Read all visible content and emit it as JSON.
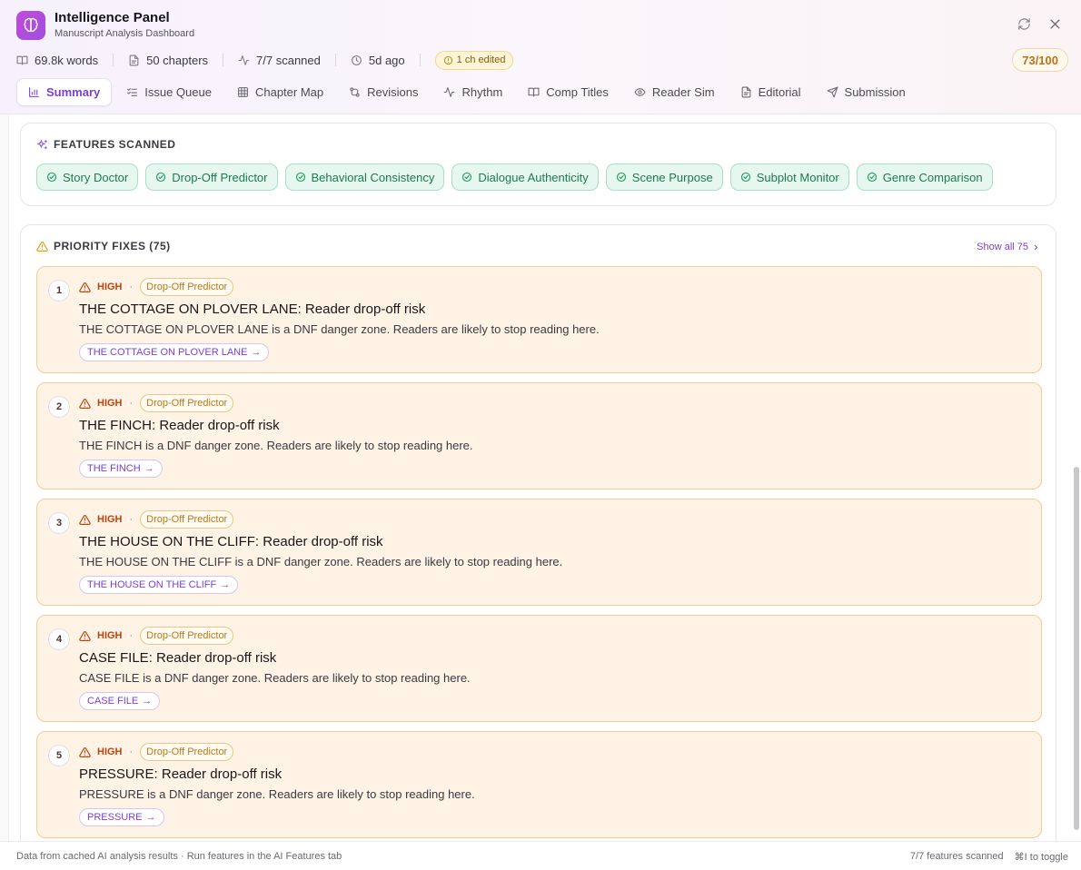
{
  "header": {
    "title": "Intelligence Panel",
    "subtitle": "Manuscript Analysis Dashboard",
    "score": "73/100"
  },
  "stats": {
    "words": "69.8k words",
    "chapters": "50 chapters",
    "scanned": "7/7 scanned",
    "age": "5d ago",
    "edited": "1 ch edited"
  },
  "tabs": [
    {
      "label": "Summary",
      "icon": "bar-chart-icon"
    },
    {
      "label": "Issue Queue",
      "icon": "list-checks-icon"
    },
    {
      "label": "Chapter Map",
      "icon": "grid-icon"
    },
    {
      "label": "Revisions",
      "icon": "git-compare-icon"
    },
    {
      "label": "Rhythm",
      "icon": "activity-icon"
    },
    {
      "label": "Comp Titles",
      "icon": "book-open-icon"
    },
    {
      "label": "Reader Sim",
      "icon": "eye-icon"
    },
    {
      "label": "Editorial",
      "icon": "file-text-icon"
    },
    {
      "label": "Submission",
      "icon": "send-icon"
    }
  ],
  "features": {
    "heading": "FEATURES SCANNED",
    "items": [
      "Story Doctor",
      "Drop-Off Predictor",
      "Behavioral Consistency",
      "Dialogue Authenticity",
      "Scene Purpose",
      "Subplot Monitor",
      "Genre Comparison"
    ]
  },
  "priority": {
    "heading": "PRIORITY FIXES (75)",
    "show_all": "Show all 75",
    "fixes": [
      {
        "num": "1",
        "severity": "HIGH",
        "dot": "·",
        "feature": "Drop-Off Predictor",
        "title": "THE COTTAGE ON PLOVER LANE: Reader drop-off risk",
        "desc": "THE COTTAGE ON PLOVER LANE is a DNF danger zone. Readers are likely to stop reading here.",
        "link": "THE COTTAGE ON PLOVER LANE"
      },
      {
        "num": "2",
        "severity": "HIGH",
        "dot": "·",
        "feature": "Drop-Off Predictor",
        "title": "THE FINCH: Reader drop-off risk",
        "desc": "THE FINCH is a DNF danger zone. Readers are likely to stop reading here.",
        "link": "THE FINCH"
      },
      {
        "num": "3",
        "severity": "HIGH",
        "dot": "·",
        "feature": "Drop-Off Predictor",
        "title": "THE HOUSE ON THE CLIFF: Reader drop-off risk",
        "desc": "THE HOUSE ON THE CLIFF is a DNF danger zone. Readers are likely to stop reading here.",
        "link": "THE HOUSE ON THE CLIFF"
      },
      {
        "num": "4",
        "severity": "HIGH",
        "dot": "·",
        "feature": "Drop-Off Predictor",
        "title": "CASE FILE: Reader drop-off risk",
        "desc": "CASE FILE is a DNF danger zone. Readers are likely to stop reading here.",
        "link": "CASE FILE"
      },
      {
        "num": "5",
        "severity": "HIGH",
        "dot": "·",
        "feature": "Drop-Off Predictor",
        "title": "PRESSURE: Reader drop-off risk",
        "desc": "PRESSURE is a DNF danger zone. Readers are likely to stop reading here.",
        "link": "PRESSURE"
      }
    ]
  },
  "footer": {
    "left": "Data from cached AI analysis results · Run features in the AI Features tab",
    "scanned": "7/7 features scanned",
    "shortcut": "⌘I to toggle"
  },
  "colors": {
    "accent": "#7b3fd6",
    "high": "#c2410c",
    "feature_tag": "#c0770f",
    "chip_green": "#1f7a4d",
    "score": "#c07016"
  }
}
